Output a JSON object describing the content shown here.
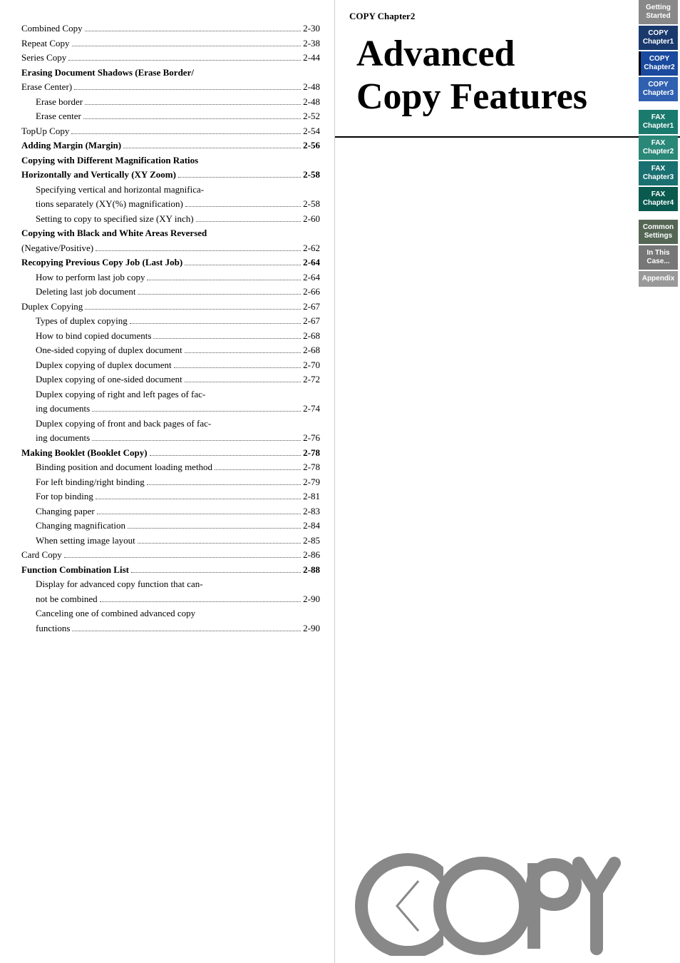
{
  "chapter_label": "COPY Chapter2",
  "chapter_title_line1": "Advanced",
  "chapter_title_line2": "Copy Features",
  "toc_entries": [
    {
      "id": 1,
      "title": "Combined Copy",
      "page": "2-30",
      "indent": 0,
      "bold": false
    },
    {
      "id": 2,
      "title": "Repeat Copy",
      "page": "2-38",
      "indent": 0,
      "bold": false
    },
    {
      "id": 3,
      "title": "Series Copy",
      "page": "2-44",
      "indent": 0,
      "bold": false
    },
    {
      "id": 4,
      "title": "Erasing Document Shadows (Erase Border/",
      "page": "",
      "indent": 0,
      "bold": true,
      "wrap": true
    },
    {
      "id": 5,
      "title": "Erase Center)",
      "page": "2-48",
      "indent": 0,
      "bold": false,
      "continuation": true
    },
    {
      "id": 6,
      "title": "Erase border",
      "page": "2-48",
      "indent": 1,
      "bold": false
    },
    {
      "id": 7,
      "title": "Erase center",
      "page": "2-52",
      "indent": 1,
      "bold": false
    },
    {
      "id": 8,
      "title": "TopUp Copy",
      "page": "2-54",
      "indent": 0,
      "bold": false
    },
    {
      "id": 9,
      "title": "Adding Margin (Margin)",
      "page": "2-56",
      "indent": 0,
      "bold": true
    },
    {
      "id": 10,
      "title": "Copying with Different Magnification Ratios",
      "page": "",
      "indent": 0,
      "bold": true,
      "nopage": true
    },
    {
      "id": 11,
      "title": "Horizontally and Vertically (XY Zoom)",
      "page": "2-58",
      "indent": 0,
      "bold": true
    },
    {
      "id": 12,
      "title": "Specifying vertical and horizontal magnifica-",
      "page": "",
      "indent": 1,
      "bold": false,
      "nopage": true
    },
    {
      "id": 13,
      "title": "tions separately (XY(%) magnification)",
      "page": "2-58",
      "indent": 1,
      "bold": false
    },
    {
      "id": 14,
      "title": "Setting to copy to specified size (XY inch)",
      "page": "2-60",
      "indent": 1,
      "bold": false
    },
    {
      "id": 15,
      "title": "Copying with Black and White Areas Reversed",
      "page": "",
      "indent": 0,
      "bold": true,
      "nopage": true
    },
    {
      "id": 16,
      "title": "(Negative/Positive)",
      "page": "2-62",
      "indent": 0,
      "bold": false
    },
    {
      "id": 17,
      "title": "Recopying Previous Copy Job (Last Job)",
      "page": "2-64",
      "indent": 0,
      "bold": true
    },
    {
      "id": 18,
      "title": "How to perform last job copy",
      "page": "2-64",
      "indent": 1,
      "bold": false
    },
    {
      "id": 19,
      "title": "Deleting last job document",
      "page": "2-66",
      "indent": 1,
      "bold": false
    },
    {
      "id": 20,
      "title": "Duplex Copying",
      "page": "2-67",
      "indent": 0,
      "bold": false
    },
    {
      "id": 21,
      "title": "Types of duplex copying",
      "page": "2-67",
      "indent": 1,
      "bold": false
    },
    {
      "id": 22,
      "title": "How to bind copied documents",
      "page": "2-68",
      "indent": 1,
      "bold": false
    },
    {
      "id": 23,
      "title": "One-sided copying of duplex document",
      "page": "2-68",
      "indent": 1,
      "bold": false
    },
    {
      "id": 24,
      "title": "Duplex copying of duplex document",
      "page": "2-70",
      "indent": 1,
      "bold": false
    },
    {
      "id": 25,
      "title": "Duplex copying of one-sided document",
      "page": "2-72",
      "indent": 1,
      "bold": false
    },
    {
      "id": 26,
      "title": "Duplex copying of right and left pages of fac-",
      "page": "",
      "indent": 1,
      "bold": false,
      "nopage": true
    },
    {
      "id": 27,
      "title": "ing documents",
      "page": "2-74",
      "indent": 1,
      "bold": false
    },
    {
      "id": 28,
      "title": "Duplex copying of front and back pages of fac-",
      "page": "",
      "indent": 1,
      "bold": false,
      "nopage": true
    },
    {
      "id": 29,
      "title": "ing documents",
      "page": "2-76",
      "indent": 1,
      "bold": false
    },
    {
      "id": 30,
      "title": "Making Booklet (Booklet Copy)",
      "page": "2-78",
      "indent": 0,
      "bold": true
    },
    {
      "id": 31,
      "title": "Binding position and document loading method",
      "page": "2-78",
      "indent": 1,
      "bold": false
    },
    {
      "id": 32,
      "title": "For left binding/right binding",
      "page": "2-79",
      "indent": 1,
      "bold": false
    },
    {
      "id": 33,
      "title": "For top binding",
      "page": "2-81",
      "indent": 1,
      "bold": false
    },
    {
      "id": 34,
      "title": "Changing paper",
      "page": "2-83",
      "indent": 1,
      "bold": false
    },
    {
      "id": 35,
      "title": "Changing magnification",
      "page": "2-84",
      "indent": 1,
      "bold": false
    },
    {
      "id": 36,
      "title": "When setting image layout",
      "page": "2-85",
      "indent": 1,
      "bold": false
    },
    {
      "id": 37,
      "title": "Card Copy",
      "page": "2-86",
      "indent": 0,
      "bold": false
    },
    {
      "id": 38,
      "title": "Function Combination List",
      "page": "2-88",
      "indent": 0,
      "bold": true
    },
    {
      "id": 39,
      "title": "Display for advanced copy function that can-",
      "page": "",
      "indent": 1,
      "bold": false,
      "nopage": true
    },
    {
      "id": 40,
      "title": "not be combined",
      "page": "2-90",
      "indent": 1,
      "bold": false
    },
    {
      "id": 41,
      "title": "Canceling one of combined advanced copy",
      "page": "",
      "indent": 1,
      "bold": false,
      "nopage": true
    },
    {
      "id": 42,
      "title": "functions",
      "page": "2-90",
      "indent": 1,
      "bold": false
    }
  ],
  "side_nav": [
    {
      "id": "getting-started",
      "label": "Getting\nStarted",
      "color": "gray"
    },
    {
      "id": "copy-chapter1",
      "label": "COPY\nChapter1",
      "color": "blue-dark"
    },
    {
      "id": "copy-chapter2",
      "label": "COPY\nChapter2",
      "color": "blue-active"
    },
    {
      "id": "copy-chapter3",
      "label": "COPY\nChapter3",
      "color": "blue-light"
    },
    {
      "id": "fax-chapter1",
      "label": "FAX\nChapter1",
      "color": "teal"
    },
    {
      "id": "fax-chapter2",
      "label": "FAX\nChapter2",
      "color": "teal-light"
    },
    {
      "id": "fax-chapter3",
      "label": "FAX\nChapter3",
      "color": "teal-mid"
    },
    {
      "id": "fax-chapter4",
      "label": "FAX\nChapter4",
      "color": "teal-dark"
    },
    {
      "id": "common-settings",
      "label": "Common\nSettings",
      "color": "common-settings"
    },
    {
      "id": "in-this-case",
      "label": "In This\nCase...",
      "color": "in-this-case"
    },
    {
      "id": "appendix",
      "label": "Appendix",
      "color": "appendix"
    }
  ]
}
